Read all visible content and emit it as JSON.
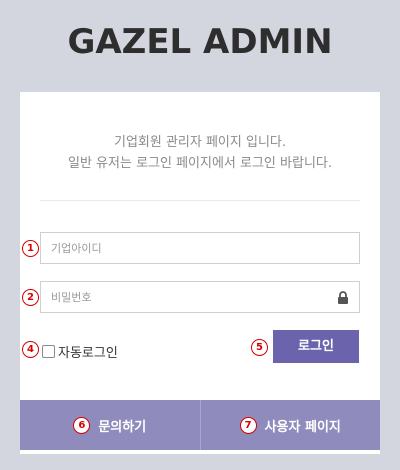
{
  "header": {
    "title": "GAZEL ADMIN"
  },
  "intro": {
    "line1": "기업회원 관리자 페이지 입니다.",
    "line2": "일반 유저는 로그인 페이지에서 로그인 바랍니다."
  },
  "form": {
    "company_id": {
      "placeholder": "기업아이디",
      "value": "",
      "badge": "1"
    },
    "password": {
      "placeholder": "비밀번호",
      "value": "",
      "badge": "2",
      "icon": "lock-icon"
    },
    "auto_login": {
      "label": "자동로그인",
      "checked": false,
      "badge": "4"
    },
    "login_button": {
      "label": "로그인",
      "badge": "5"
    }
  },
  "footer": {
    "inquiry": {
      "label": "문의하기",
      "badge": "6"
    },
    "user_page": {
      "label": "사용자 페이지",
      "badge": "7"
    }
  },
  "colors": {
    "background": "#d3d6df",
    "button": "#6b64ad",
    "footer": "#8f8cbd",
    "badge": "#d60000"
  }
}
